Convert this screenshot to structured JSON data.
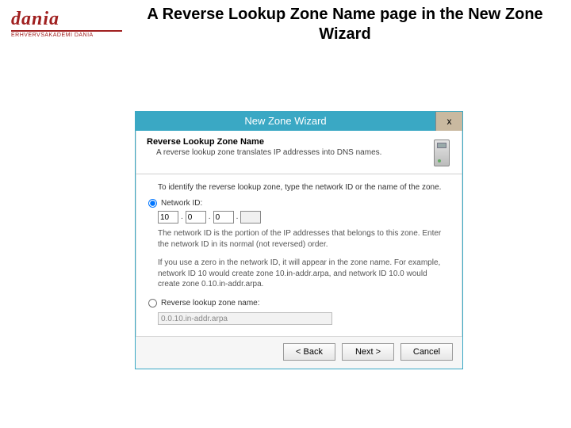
{
  "slide": {
    "logo_mark": "dania",
    "logo_sub": "ERHVERVSAKADEMI DANIA",
    "title": "A Reverse Lookup Zone Name page in the New Zone Wizard"
  },
  "wizard": {
    "title": "New Zone Wizard",
    "close_label": "x",
    "header_title": "Reverse Lookup Zone Name",
    "header_sub": "A reverse lookup zone translates IP addresses into DNS names.",
    "instruction": "To identify the reverse lookup zone, type the network ID or the name of the zone.",
    "option_network_id": "Network ID:",
    "net_octets": [
      "10",
      "0",
      "0",
      ""
    ],
    "para_network_id": "The network ID is the portion of the IP addresses that belongs to this zone. Enter the network ID in its normal (not reversed) order.",
    "para_zero": "If you use a zero in the network ID, it will appear in the zone name. For example, network ID 10 would create zone 10.in-addr.arpa, and network ID 10.0 would create zone 0.10.in-addr.arpa.",
    "option_zone_name": "Reverse lookup zone name:",
    "zone_name_value": "0.0.10.in-addr.arpa",
    "buttons": {
      "back": "< Back",
      "next": "Next >",
      "cancel": "Cancel"
    }
  }
}
